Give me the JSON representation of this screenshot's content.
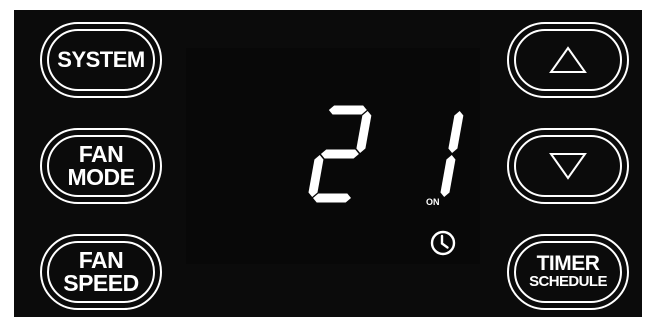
{
  "buttons": {
    "system": "SYSTEM",
    "fan_mode_line1": "FAN",
    "fan_mode_line2": "MODE",
    "fan_speed_line1": "FAN",
    "fan_speed_line2": "SPEED",
    "timer_line1": "TIMER",
    "timer_line2": "SCHEDULE",
    "up_icon": "triangle-up-icon",
    "down_icon": "triangle-down-icon"
  },
  "display": {
    "temperature": "21",
    "fan_status": "ON",
    "timer_icon": "clock-icon"
  },
  "colors": {
    "panel": "#0b0b0b",
    "foreground": "#ffffff"
  }
}
